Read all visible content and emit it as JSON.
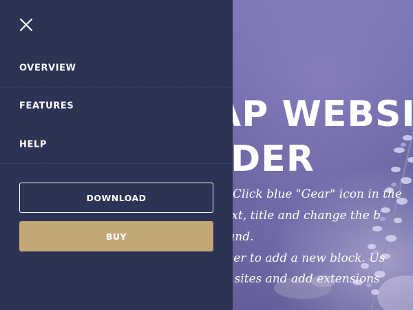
{
  "colors": {
    "panel_background": "#2c3354",
    "buy_button": "#c4a777",
    "text": "#ffffff",
    "hero_tint": "#6f6aa8"
  },
  "menu": {
    "close_icon": "close-icon",
    "items": [
      {
        "label": "OVERVIEW"
      },
      {
        "label": "FEATURES"
      },
      {
        "label": "HELP"
      }
    ],
    "download_label": "DOWNLOAD",
    "buy_label": "BUY"
  },
  "hero": {
    "title_line1": "AP WEBSIT",
    "title_line2": "LDER",
    "text_lines": [
      "Click blue \"Gear\" icon in the",
      "s, text, title and change the b",
      "round.",
      "orner to add a new block. Us",
      "ges, sites and add extensions"
    ]
  }
}
